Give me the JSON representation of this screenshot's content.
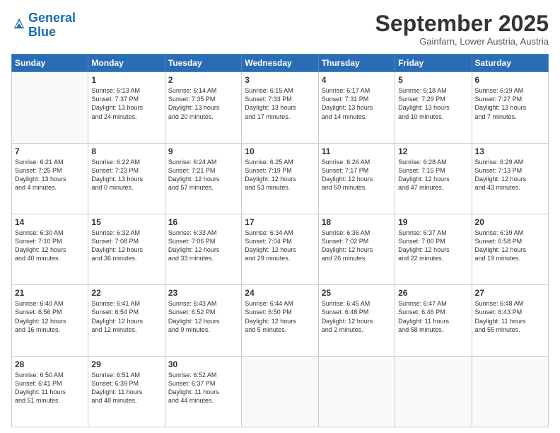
{
  "header": {
    "logo_line1": "General",
    "logo_line2": "Blue",
    "month": "September 2025",
    "location": "Gainfarn, Lower Austria, Austria"
  },
  "days_of_week": [
    "Sunday",
    "Monday",
    "Tuesday",
    "Wednesday",
    "Thursday",
    "Friday",
    "Saturday"
  ],
  "weeks": [
    [
      {
        "day": "",
        "info": ""
      },
      {
        "day": "1",
        "info": "Sunrise: 6:13 AM\nSunset: 7:37 PM\nDaylight: 13 hours\nand 24 minutes."
      },
      {
        "day": "2",
        "info": "Sunrise: 6:14 AM\nSunset: 7:35 PM\nDaylight: 13 hours\nand 20 minutes."
      },
      {
        "day": "3",
        "info": "Sunrise: 6:15 AM\nSunset: 7:33 PM\nDaylight: 13 hours\nand 17 minutes."
      },
      {
        "day": "4",
        "info": "Sunrise: 6:17 AM\nSunset: 7:31 PM\nDaylight: 13 hours\nand 14 minutes."
      },
      {
        "day": "5",
        "info": "Sunrise: 6:18 AM\nSunset: 7:29 PM\nDaylight: 13 hours\nand 10 minutes."
      },
      {
        "day": "6",
        "info": "Sunrise: 6:19 AM\nSunset: 7:27 PM\nDaylight: 13 hours\nand 7 minutes."
      }
    ],
    [
      {
        "day": "7",
        "info": "Sunrise: 6:21 AM\nSunset: 7:25 PM\nDaylight: 13 hours\nand 4 minutes."
      },
      {
        "day": "8",
        "info": "Sunrise: 6:22 AM\nSunset: 7:23 PM\nDaylight: 13 hours\nand 0 minutes."
      },
      {
        "day": "9",
        "info": "Sunrise: 6:24 AM\nSunset: 7:21 PM\nDaylight: 12 hours\nand 57 minutes."
      },
      {
        "day": "10",
        "info": "Sunrise: 6:25 AM\nSunset: 7:19 PM\nDaylight: 12 hours\nand 53 minutes."
      },
      {
        "day": "11",
        "info": "Sunrise: 6:26 AM\nSunset: 7:17 PM\nDaylight: 12 hours\nand 50 minutes."
      },
      {
        "day": "12",
        "info": "Sunrise: 6:28 AM\nSunset: 7:15 PM\nDaylight: 12 hours\nand 47 minutes."
      },
      {
        "day": "13",
        "info": "Sunrise: 6:29 AM\nSunset: 7:13 PM\nDaylight: 12 hours\nand 43 minutes."
      }
    ],
    [
      {
        "day": "14",
        "info": "Sunrise: 6:30 AM\nSunset: 7:10 PM\nDaylight: 12 hours\nand 40 minutes."
      },
      {
        "day": "15",
        "info": "Sunrise: 6:32 AM\nSunset: 7:08 PM\nDaylight: 12 hours\nand 36 minutes."
      },
      {
        "day": "16",
        "info": "Sunrise: 6:33 AM\nSunset: 7:06 PM\nDaylight: 12 hours\nand 33 minutes."
      },
      {
        "day": "17",
        "info": "Sunrise: 6:34 AM\nSunset: 7:04 PM\nDaylight: 12 hours\nand 29 minutes."
      },
      {
        "day": "18",
        "info": "Sunrise: 6:36 AM\nSunset: 7:02 PM\nDaylight: 12 hours\nand 26 minutes."
      },
      {
        "day": "19",
        "info": "Sunrise: 6:37 AM\nSunset: 7:00 PM\nDaylight: 12 hours\nand 22 minutes."
      },
      {
        "day": "20",
        "info": "Sunrise: 6:39 AM\nSunset: 6:58 PM\nDaylight: 12 hours\nand 19 minutes."
      }
    ],
    [
      {
        "day": "21",
        "info": "Sunrise: 6:40 AM\nSunset: 6:56 PM\nDaylight: 12 hours\nand 16 minutes."
      },
      {
        "day": "22",
        "info": "Sunrise: 6:41 AM\nSunset: 6:54 PM\nDaylight: 12 hours\nand 12 minutes."
      },
      {
        "day": "23",
        "info": "Sunrise: 6:43 AM\nSunset: 6:52 PM\nDaylight: 12 hours\nand 9 minutes."
      },
      {
        "day": "24",
        "info": "Sunrise: 6:44 AM\nSunset: 6:50 PM\nDaylight: 12 hours\nand 5 minutes."
      },
      {
        "day": "25",
        "info": "Sunrise: 6:45 AM\nSunset: 6:48 PM\nDaylight: 12 hours\nand 2 minutes."
      },
      {
        "day": "26",
        "info": "Sunrise: 6:47 AM\nSunset: 6:46 PM\nDaylight: 11 hours\nand 58 minutes."
      },
      {
        "day": "27",
        "info": "Sunrise: 6:48 AM\nSunset: 6:43 PM\nDaylight: 11 hours\nand 55 minutes."
      }
    ],
    [
      {
        "day": "28",
        "info": "Sunrise: 6:50 AM\nSunset: 6:41 PM\nDaylight: 11 hours\nand 51 minutes."
      },
      {
        "day": "29",
        "info": "Sunrise: 6:51 AM\nSunset: 6:39 PM\nDaylight: 11 hours\nand 48 minutes."
      },
      {
        "day": "30",
        "info": "Sunrise: 6:52 AM\nSunset: 6:37 PM\nDaylight: 11 hours\nand 44 minutes."
      },
      {
        "day": "",
        "info": ""
      },
      {
        "day": "",
        "info": ""
      },
      {
        "day": "",
        "info": ""
      },
      {
        "day": "",
        "info": ""
      }
    ]
  ]
}
